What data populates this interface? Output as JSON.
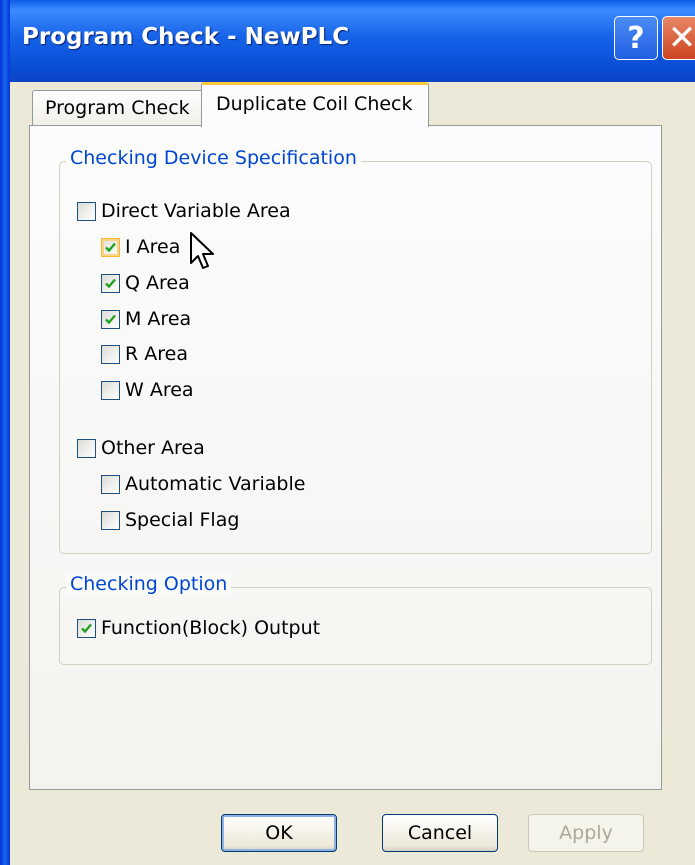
{
  "window": {
    "title": "Program Check - NewPLC"
  },
  "title_buttons": {
    "help": "?",
    "close": "✕"
  },
  "tabs": [
    {
      "label": "Program Check",
      "active": false
    },
    {
      "label": "Duplicate Coil Check",
      "active": true
    }
  ],
  "device_spec": {
    "title": "Checking Device Specification",
    "items": [
      {
        "label": "Direct Variable Area",
        "checked": false
      },
      {
        "label": "I Area",
        "checked": true
      },
      {
        "label": "Q Area",
        "checked": true
      },
      {
        "label": "M Area",
        "checked": true
      },
      {
        "label": "R Area",
        "checked": false
      },
      {
        "label": "W Area",
        "checked": false
      },
      {
        "label": "Other Area",
        "checked": false
      },
      {
        "label": "Automatic Variable",
        "checked": false
      },
      {
        "label": "Special Flag",
        "checked": false
      }
    ]
  },
  "checking_option": {
    "title": "Checking Option",
    "items": [
      {
        "label": "Function(Block) Output",
        "checked": true
      }
    ]
  },
  "buttons": {
    "ok": "OK",
    "cancel": "Cancel",
    "apply": "Apply"
  },
  "colors": {
    "group_title": "#0046d5",
    "titlebar": "#0a5ae8",
    "check_green": "#21a121"
  }
}
